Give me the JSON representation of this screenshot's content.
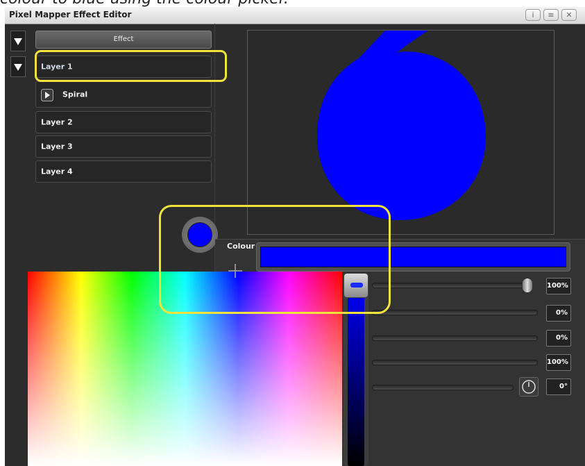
{
  "caption": "colour to blue using the colour picker.",
  "window": {
    "title": "Pixel Mapper Effect Editor",
    "title_buttons": [
      {
        "icon": "info-icon",
        "glyph": "i"
      },
      {
        "icon": "menu-icon",
        "glyph": "≡"
      },
      {
        "icon": "close-icon",
        "glyph": "✕"
      }
    ]
  },
  "layers_panel": {
    "effect_label": "Effect",
    "layers": [
      {
        "label": "Layer 1",
        "selected": true,
        "expanded": true
      },
      {
        "label": "Layer 2"
      },
      {
        "label": "Layer 3"
      },
      {
        "label": "Layer 4"
      }
    ],
    "sub_item": {
      "label": "Spiral",
      "icon": "play-icon"
    }
  },
  "preview": {
    "shape": "spiral",
    "color": "#0000ff"
  },
  "parameters": {
    "colour_label": "Colour",
    "colour_value": "#0000ff",
    "sliders": [
      {
        "value": "100%",
        "level": 1.0
      },
      {
        "value": "0%",
        "level": 0.0
      },
      {
        "value": "0%",
        "level": 0.0
      },
      {
        "value": "100%",
        "level": 1.0
      },
      {
        "value": "0°",
        "level": 0.0
      }
    ]
  },
  "colour_picker": {
    "selected_hue": "blue",
    "brightness_level": 1.0
  },
  "highlight_color": "#f2e23c"
}
